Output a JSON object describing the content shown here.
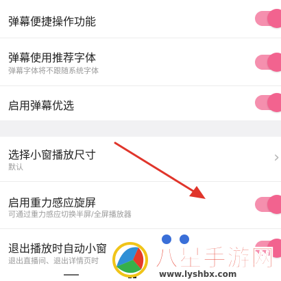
{
  "settings_group_1": [
    {
      "title": "弹幕便捷操作功能",
      "subtitle": "",
      "control": "toggle",
      "on": true
    },
    {
      "title": "弹幕使用推荐字体",
      "subtitle": "弹幕字体将不跟随系统字体",
      "control": "toggle",
      "on": true
    },
    {
      "title": "启用弹幕优选",
      "subtitle": "",
      "control": "toggle",
      "on": true
    }
  ],
  "settings_group_2": [
    {
      "title": "选择小窗播放尺寸",
      "subtitle": "默认",
      "control": "chevron"
    },
    {
      "title": "启用重力感应旋屏",
      "subtitle": "可通过重力感应切换半屏/全屏播放器",
      "control": "toggle",
      "on": true
    },
    {
      "title": "退出播放时自动小窗",
      "subtitle": "退出直播间、退出详情页时",
      "control": "toggle",
      "on": true
    }
  ],
  "colors": {
    "accent": "#f2638f",
    "track": "#f58fae",
    "arrow": "#e0352b"
  },
  "icons": {
    "chevron": "chevron-right-icon"
  },
  "watermark": {
    "title": "八星手游网",
    "url": "www.lyshbx.com"
  }
}
